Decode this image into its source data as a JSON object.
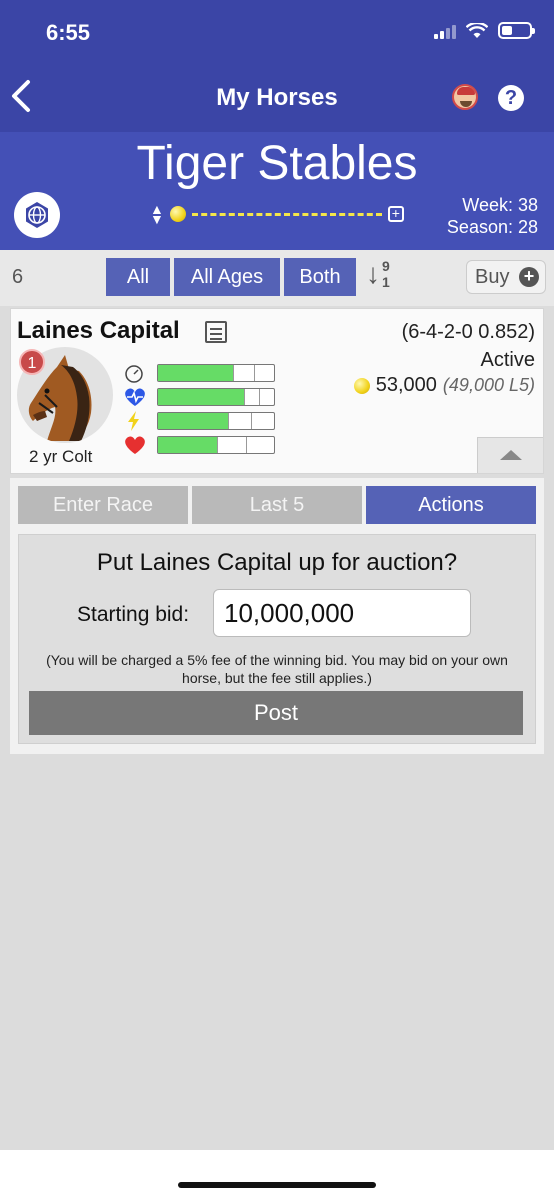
{
  "status_bar": {
    "time": "6:55"
  },
  "nav": {
    "title": "My Horses",
    "back_icon": "chevron-left-icon",
    "help_label": "?"
  },
  "stable": {
    "name": "Tiger Stables",
    "week": "Week: 38",
    "season": "Season: 28",
    "progress_fraction": 0.0
  },
  "filters": {
    "count": "6",
    "buttons": [
      {
        "label": "All"
      },
      {
        "label": "All Ages"
      },
      {
        "label": "Both"
      }
    ],
    "sort_top": "9",
    "sort_bottom": "1",
    "buy_label": "Buy"
  },
  "horse": {
    "name": "Laines Capital",
    "record": "(6-4-2-0 0.852)",
    "status": "Active",
    "value": "53,000",
    "value_l5": "(49,000 L5)",
    "badge": "1",
    "age": "2 yr Colt",
    "stats": [
      {
        "icon": "speedometer-icon",
        "fill": 0.65
      },
      {
        "icon": "stamina-heart-icon",
        "fill": 0.74
      },
      {
        "icon": "lightning-icon",
        "fill": 0.6
      },
      {
        "icon": "heart-icon",
        "fill": 0.51
      }
    ]
  },
  "tabs": [
    {
      "label": "Enter Race"
    },
    {
      "label": "Last 5"
    },
    {
      "label": "Actions"
    }
  ],
  "auction": {
    "question": "Put Laines Capital up for auction?",
    "bid_label": "Starting bid:",
    "bid_value": "10,000,000",
    "fee_note": "(You will be charged a 5% fee of the winning bid. You may bid on your own horse, but the fee still applies.)",
    "post_label": "Post"
  },
  "colors": {
    "nav": "#3b45a6",
    "header": "#4450b6",
    "button": "#5562b6",
    "stat_fill": "#66dc66"
  }
}
